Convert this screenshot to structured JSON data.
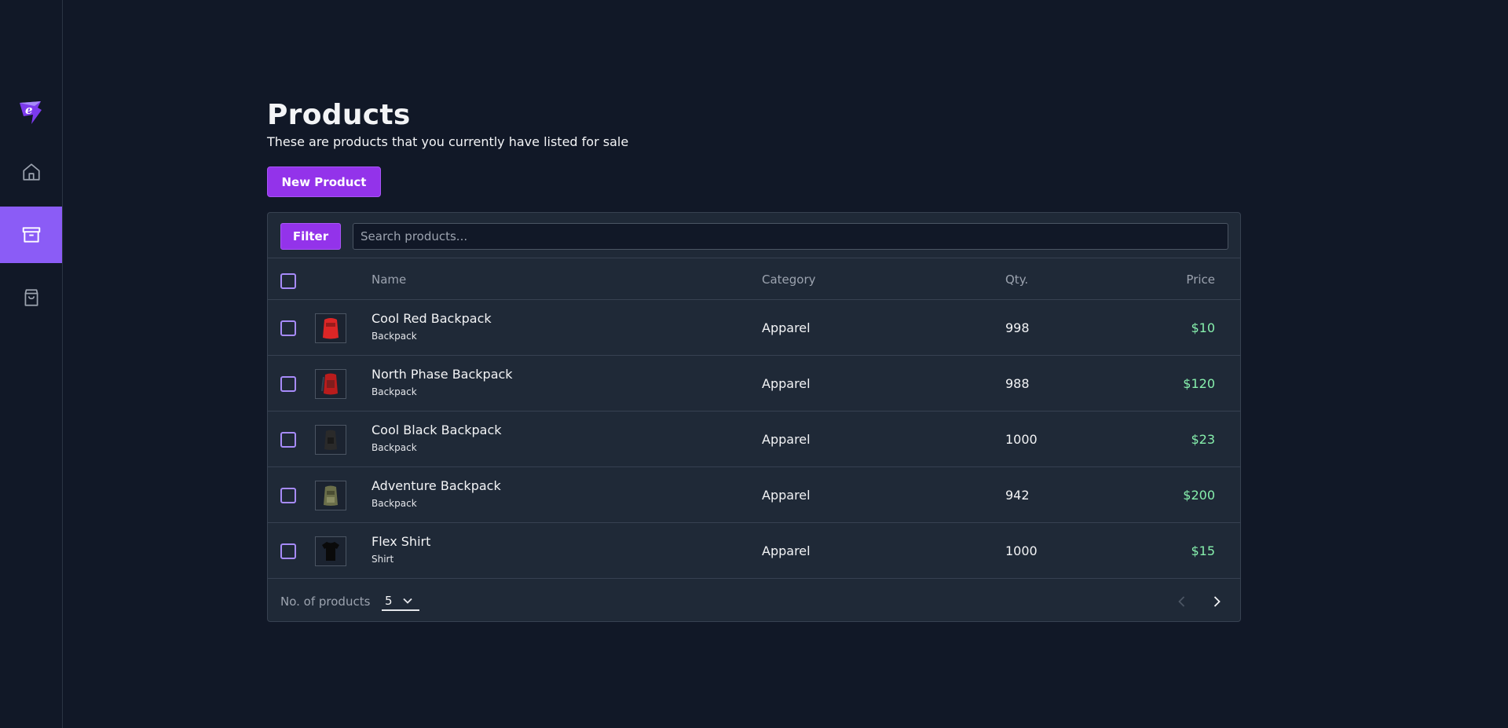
{
  "sidebar": {
    "logo_icon": "brand-logo-icon",
    "items": [
      {
        "name": "home",
        "icon": "home-icon",
        "active": false
      },
      {
        "name": "products",
        "icon": "archive-box-icon",
        "active": true
      },
      {
        "name": "orders",
        "icon": "shopping-bag-icon",
        "active": false
      }
    ]
  },
  "header": {
    "title": "Products",
    "subtitle": "These are products that you currently have listed for sale",
    "new_button": "New Product"
  },
  "toolbar": {
    "filter_label": "Filter",
    "search_placeholder": "Search products..."
  },
  "table": {
    "columns": [
      "Name",
      "Category",
      "Qty.",
      "Price"
    ],
    "rows": [
      {
        "name": "Cool Red Backpack",
        "type": "Backpack",
        "category": "Apparel",
        "qty": "998",
        "price": "$10",
        "thumb_color": "#dc2626"
      },
      {
        "name": "North Phase Backpack",
        "type": "Backpack",
        "category": "Apparel",
        "qty": "988",
        "price": "$120",
        "thumb_color": "#b91c1c"
      },
      {
        "name": "Cool Black Backpack",
        "type": "Backpack",
        "category": "Apparel",
        "qty": "1000",
        "price": "$23",
        "thumb_color": "#2a2a2a"
      },
      {
        "name": "Adventure Backpack",
        "type": "Backpack",
        "category": "Apparel",
        "qty": "942",
        "price": "$200",
        "thumb_color": "#6b6f4a"
      },
      {
        "name": "Flex Shirt",
        "type": "Shirt",
        "category": "Apparel",
        "qty": "1000",
        "price": "$15",
        "thumb_color": "#0a0a0a"
      }
    ]
  },
  "footer": {
    "per_page_label": "No. of products",
    "per_page_value": "5"
  },
  "colors": {
    "accent": "#9333ea",
    "background": "#111827",
    "price": "#86efac"
  }
}
